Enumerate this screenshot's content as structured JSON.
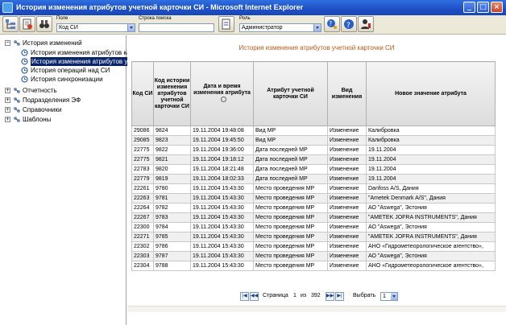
{
  "window": {
    "title": "История изменения атрибутов учетной карточки СИ - Microsoft Internet Explorer"
  },
  "toolbar": {
    "field_label": "Поле",
    "field_value": "Код СИ",
    "search_label": "Строка поиска",
    "search_value": "",
    "role_label": "Роль",
    "role_value": "Администратор"
  },
  "tree": {
    "items": [
      {
        "label": "История изменений",
        "level": 0,
        "expander": "−"
      },
      {
        "label": "История изменения атрибутов кар",
        "level": 1
      },
      {
        "label": "История изменения атрибутов уче",
        "level": 1,
        "selected": true
      },
      {
        "label": "История операций над СИ",
        "level": 1
      },
      {
        "label": "История синхронизации",
        "level": 1
      },
      {
        "label": "Отчетность",
        "level": 0,
        "expander": "+"
      },
      {
        "label": "Подразделения ЭФ",
        "level": 0,
        "expander": "+"
      },
      {
        "label": "Справочники",
        "level": 0,
        "expander": "+"
      },
      {
        "label": "Шаблоны",
        "level": 0,
        "expander": "+"
      }
    ]
  },
  "main": {
    "title": "История изменения атрибутов учетной карточки СИ",
    "columns": [
      "Код СИ",
      "Код истории изменения атрибутов учетной карточки СИ",
      "Дата и время изменения атрибута",
      "Атрибут учетной карточки СИ",
      "Вид изменения",
      "Новое значение атрибута"
    ],
    "rows": [
      [
        "29086",
        "9824",
        "19.11.2004 19:48:08",
        "Вид МР",
        "Изменение",
        "Калибровка"
      ],
      [
        "29085",
        "9823",
        "19.11.2004 19:45:50",
        "Вид МР",
        "Изменение",
        "Калибровка"
      ],
      [
        "22775",
        "9822",
        "19.11.2004 19:36:00",
        "Дата последней МР",
        "Изменение",
        "19.11.2004"
      ],
      [
        "22775",
        "9821",
        "19.11.2004 19:18:12",
        "Дата последней МР",
        "Изменение",
        "19.11.2004"
      ],
      [
        "22783",
        "9820",
        "19.11.2004 18:21:48",
        "Дата последней МР",
        "Изменение",
        "19.11.2004"
      ],
      [
        "22779",
        "9819",
        "19.11.2004 18:02:33",
        "Дата последней МР",
        "Изменение",
        "19.11.2004"
      ],
      [
        "22261",
        "9780",
        "19.11.2004 15:43:30",
        "Место проведения МР",
        "Изменение",
        "Danfoss A/S, Дания"
      ],
      [
        "22263",
        "9781",
        "19.11.2004 15:43:30",
        "Место проведения МР",
        "Изменение",
        "\"Ametek Denmark A/S\", Дания"
      ],
      [
        "22264",
        "9782",
        "19.11.2004 15:43:30",
        "Место проведения МР",
        "Изменение",
        "АО \"Aswega\", Эстония"
      ],
      [
        "22267",
        "9783",
        "19.11.2004 15:43:30",
        "Место проведения МР",
        "Изменение",
        "\"AMETEK JOFRA INSTRUMENTS\", Дания"
      ],
      [
        "22300",
        "9784",
        "19.11.2004 15:43:30",
        "Место проведения МР",
        "Изменение",
        "АО \"Aswega\", Эстония"
      ],
      [
        "22271",
        "9785",
        "19.11.2004 15:43:30",
        "Место проведения МР",
        "Изменение",
        "\"AMETEK JOFRA INSTRUMENTS\", Дания"
      ],
      [
        "22302",
        "9786",
        "19.11.2004 15:43:30",
        "Место проведения МР",
        "Изменение",
        "АНО «Гидрометеорологическое агентство»,"
      ],
      [
        "22303",
        "9787",
        "19.11.2004 15:43:30",
        "Место проведения МР",
        "Изменение",
        "АО \"Aswega\", Эстония"
      ],
      [
        "22304",
        "9788",
        "19.11.2004 15:43:30",
        "Место проведения МР",
        "Изменение",
        "АНО «Гидрометеорологическое агентство»,"
      ]
    ]
  },
  "pager": {
    "page_word": "Страница",
    "current": "1",
    "of_word": "из",
    "total": "392",
    "select_label": "Выбрать",
    "select_value": "1"
  }
}
